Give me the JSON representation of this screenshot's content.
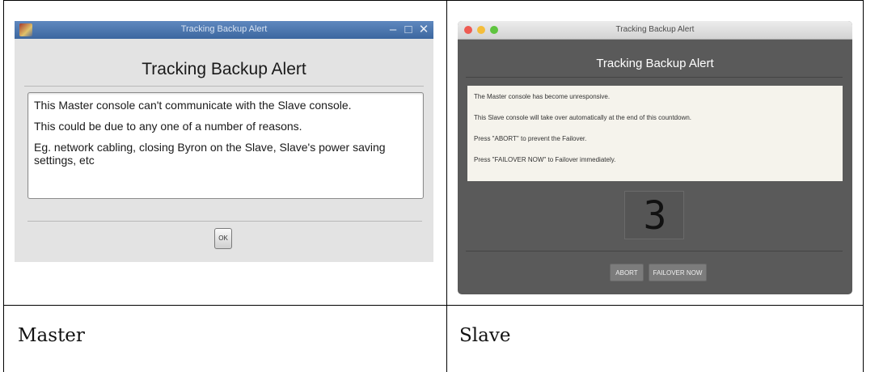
{
  "master": {
    "window_title": "Tracking Backup Alert",
    "heading": "Tracking Backup Alert",
    "messages": [
      "This Master console can't communicate with the Slave console.",
      "This could be due to any one of a number of reasons.",
      "Eg. network cabling, closing Byron on the Slave, Slave's power saving settings, etc"
    ],
    "ok_label": "OK",
    "icons": {
      "app": "app-icon",
      "minimize": "minimize-icon",
      "maximize": "maximize-icon",
      "close": "close-icon"
    },
    "colors": {
      "titlebar": "#4a74ad",
      "background": "#e3e3e3"
    }
  },
  "slave": {
    "window_title": "Tracking Backup Alert",
    "heading": "Tracking Backup Alert",
    "messages": [
      "The Master console has become unresponsive.",
      "This Slave console will take over automatically at the end of this countdown.",
      "Press \"ABORT\" to prevent the Failover.",
      "Press \"FAILOVER NOW\" to Failover immediately."
    ],
    "countdown": "3",
    "abort_label": "ABORT",
    "failover_label": "FAILOVER NOW",
    "traffic_lights": {
      "close": "#ee5b52",
      "minimize": "#f4bd3a",
      "zoom": "#5fc43f"
    },
    "colors": {
      "background": "#5a5a5a",
      "message_bg": "#f5f3ec"
    }
  },
  "captions": {
    "left": "Master",
    "right": "Slave"
  }
}
